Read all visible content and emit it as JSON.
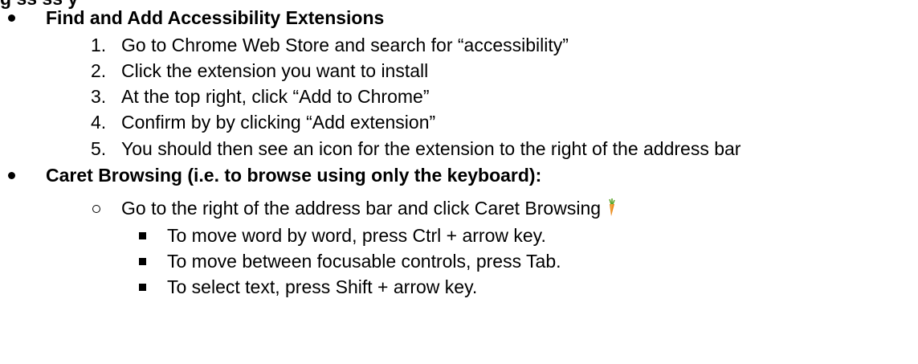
{
  "clipped_heading": "g   ss         ss           y",
  "section1": {
    "heading": "Find and Add Accessibility Extensions",
    "steps": [
      {
        "num": "1.",
        "text": "Go to Chrome Web Store and search for “accessibility”"
      },
      {
        "num": "2.",
        "text": "Click the extension you want to install"
      },
      {
        "num": "3.",
        "text": "At the top right, click “Add to Chrome”"
      },
      {
        "num": "4.",
        "text": "Confirm by by clicking “Add extension”"
      },
      {
        "num": "5.",
        "text": "You should then see an icon for the extension to the right of the address bar"
      }
    ]
  },
  "section2": {
    "heading": "Caret Browsing (i.e. to browse using only the keyboard):",
    "sub_item": "Go to the right of the address bar and click Caret Browsing",
    "icon": "carrot-icon",
    "tips": [
      "To move word by word, press Ctrl + arrow key.",
      "To move between focusable controls, press Tab.",
      "To select text, press Shift + arrow key."
    ]
  }
}
